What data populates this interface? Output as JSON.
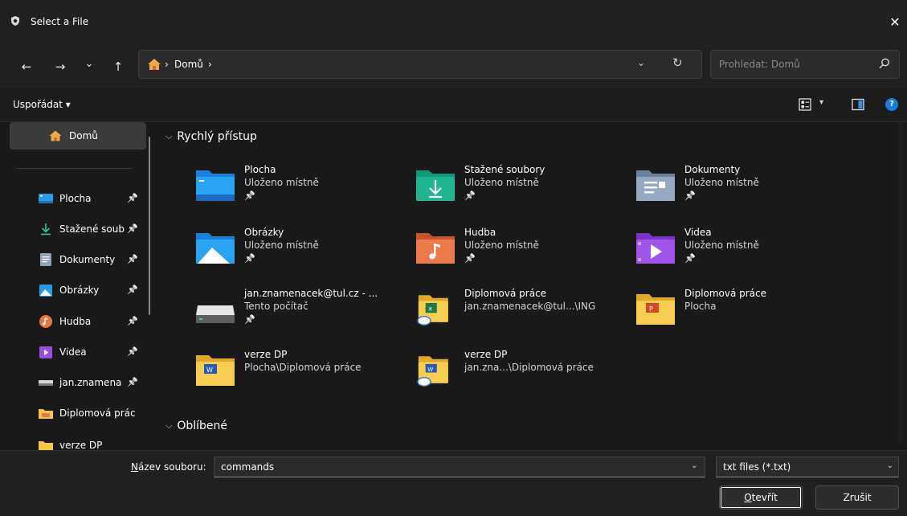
{
  "window": {
    "title": "Select a File",
    "close_glyph": "✕",
    "icon": "app-shield-icon"
  },
  "navigation": {
    "back_glyph": "←",
    "forward_glyph": "→",
    "recent_glyph": "⌄",
    "up_glyph": "↑",
    "breadcrumb": {
      "separator": "›",
      "location": "Domů"
    },
    "address_dropdown_glyph": "⌄",
    "refresh_glyph": "↻",
    "search": {
      "placeholder": "Prohledat: Domů"
    }
  },
  "commandbar": {
    "sort_label": "Uspořádat",
    "sort_caret": "▾",
    "view_caret": "▾",
    "help_glyph": "?"
  },
  "sidebar": {
    "selected": {
      "label": "Domů",
      "icon": "home-icon"
    },
    "items": [
      {
        "label": "Plocha",
        "icon": "desktop-icon",
        "pinned": true
      },
      {
        "label": "Stažené soub",
        "icon": "downloads-icon",
        "pinned": true
      },
      {
        "label": "Dokumenty",
        "icon": "documents-icon",
        "pinned": true
      },
      {
        "label": "Obrázky",
        "icon": "pictures-icon",
        "pinned": true
      },
      {
        "label": "Hudba",
        "icon": "music-icon",
        "pinned": true
      },
      {
        "label": "Videa",
        "icon": "videos-icon",
        "pinned": true
      },
      {
        "label": "jan.znamena",
        "icon": "drive-icon",
        "pinned": true
      },
      {
        "label": "Diplomová prác",
        "icon": "folder-icon",
        "pinned": false
      },
      {
        "label": "verze DP",
        "icon": "folder-icon",
        "pinned": false
      }
    ],
    "pin_glyph": "📌"
  },
  "main": {
    "sections": [
      {
        "label": "Rychlý přístup",
        "chevron": "⌵"
      },
      {
        "label": "Oblíbené",
        "chevron": "⌵"
      }
    ],
    "quick_access": [
      {
        "name": "Plocha",
        "sub": "Uloženo místně",
        "pinned": true,
        "icon": "desktop-folder-icon"
      },
      {
        "name": "Stažené soubory",
        "sub": "Uloženo místně",
        "pinned": true,
        "icon": "downloads-folder-icon"
      },
      {
        "name": "Dokumenty",
        "sub": "Uloženo místně",
        "pinned": true,
        "icon": "documents-folder-icon"
      },
      {
        "name": "Obrázky",
        "sub": "Uloženo místně",
        "pinned": true,
        "icon": "pictures-folder-icon"
      },
      {
        "name": "Hudba",
        "sub": "Uloženo místně",
        "pinned": true,
        "icon": "music-folder-icon"
      },
      {
        "name": "Videa",
        "sub": "Uloženo místně",
        "pinned": true,
        "icon": "videos-folder-icon"
      },
      {
        "name": "jan.znamenacek@tul.cz - ...",
        "sub": "Tento počítač",
        "pinned": true,
        "icon": "network-drive-icon"
      },
      {
        "name": "Diplomová práce",
        "sub": "jan.znamenacek@tul...\\ING",
        "pinned": false,
        "icon": "excel-cloud-folder-icon"
      },
      {
        "name": "Diplomová práce",
        "sub": "Plocha",
        "pinned": false,
        "icon": "powerpoint-folder-icon"
      },
      {
        "name": "verze DP",
        "sub": "Plocha\\Diplomová práce",
        "pinned": false,
        "icon": "word-folder-icon"
      },
      {
        "name": "verze DP",
        "sub": "jan.zna...\\Diplomová práce",
        "pinned": false,
        "icon": "word-cloud-folder-icon"
      }
    ]
  },
  "footer": {
    "filename_label_hotkey": "N",
    "filename_label_rest": "ázev souboru:",
    "filename_value": "commands",
    "filename_dropdown_glyph": "⌄",
    "filetype_value": "txt files (*.txt)",
    "filetype_dropdown_glyph": "⌄",
    "open_hotkey": "O",
    "open_rest": "tevřít",
    "cancel_label": "Zrušit"
  },
  "colors": {
    "background": "#191919",
    "chrome": "#202020",
    "folder_yellow": "#f5c543",
    "accent_blue": "#1a7be0"
  }
}
